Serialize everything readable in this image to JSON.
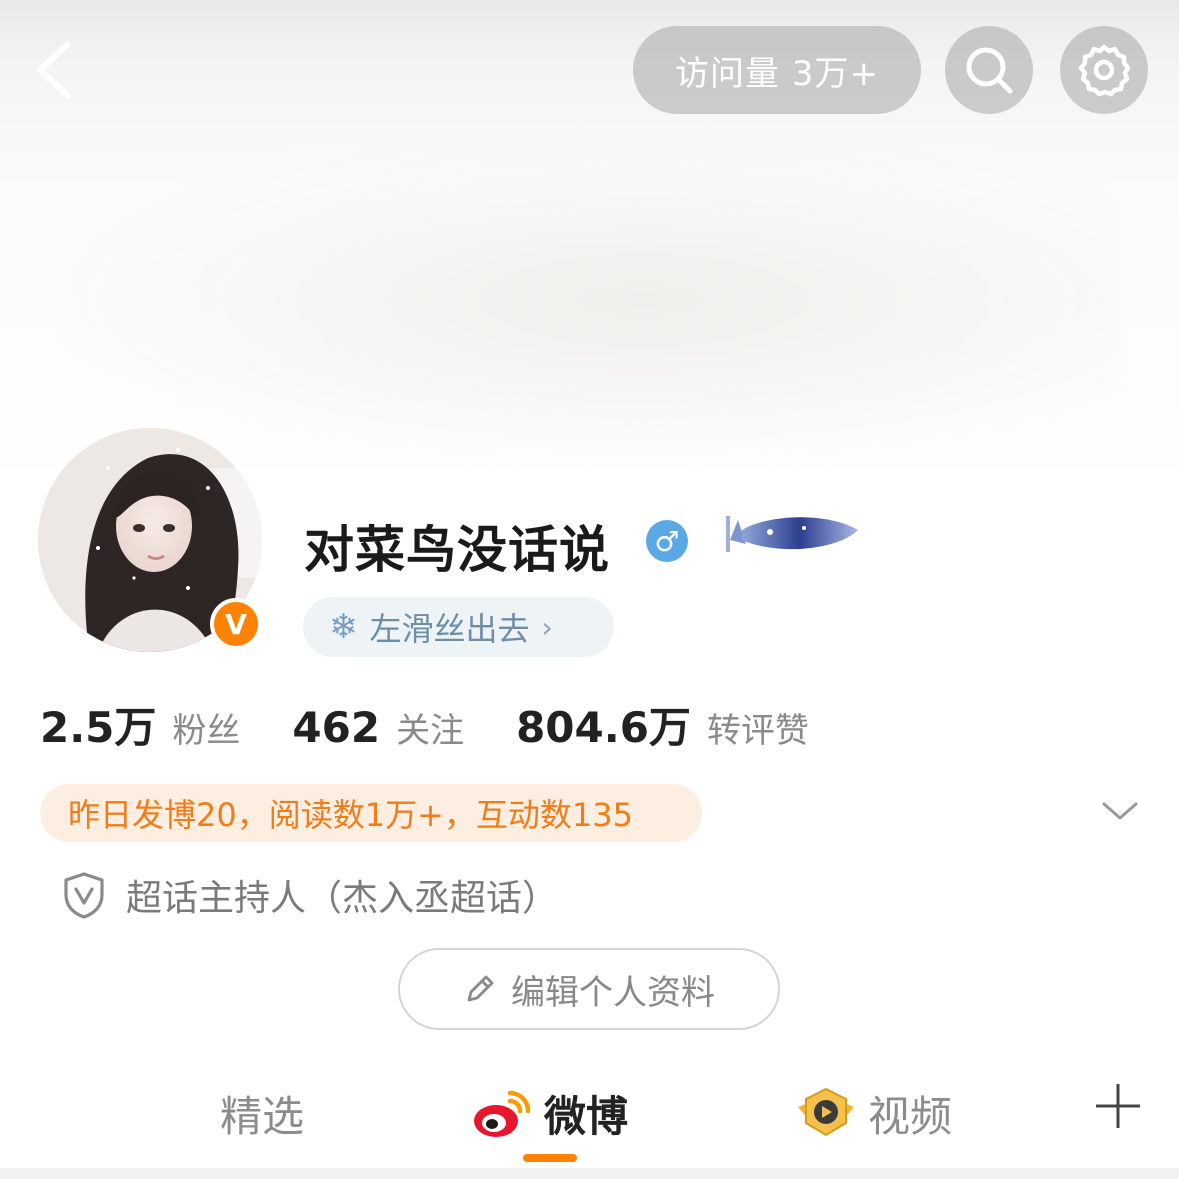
{
  "header": {
    "visits_label": "访问量 3万+"
  },
  "profile": {
    "username": "对菜鸟没话说",
    "gender_symbol": "♂",
    "verified_badge": "V",
    "follow_hint": "左滑丝出去",
    "follow_hint_chevron": "›",
    "snow_symbol": "❄"
  },
  "stats": [
    {
      "value": "2.5万",
      "label": "粉丝"
    },
    {
      "value": "462",
      "label": "关注"
    },
    {
      "value": "804.6万",
      "label": "转评赞"
    }
  ],
  "summary": "昨日发博20，阅读数1万+，互动数135",
  "role": "超话主持人（杰入丞超话）",
  "edit_button_label": "编辑个人资料",
  "tabs": [
    {
      "label": "精选"
    },
    {
      "label": "微博"
    },
    {
      "label": "视频"
    }
  ],
  "colors": {
    "accent": "#ff8200",
    "summary_text": "#f07c1a",
    "summary_bg": "#fdeee2",
    "gender_blue": "#5aa9e6"
  }
}
